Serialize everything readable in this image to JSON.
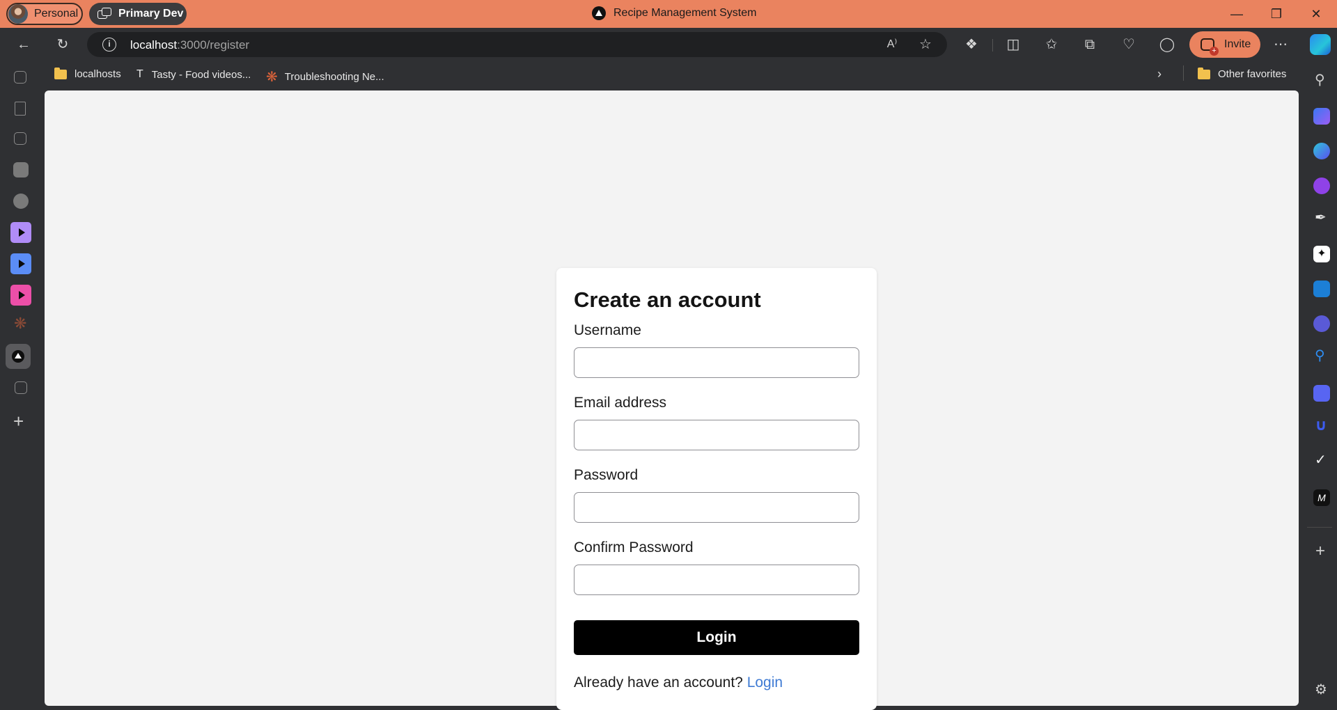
{
  "browser": {
    "window_title": "Recipe Management System",
    "profile_name": "Personal",
    "workspace_name": "Primary Dev",
    "url_host": "localhost",
    "url_path": ":3000/register",
    "invite_label": "Invite",
    "favorites": [
      {
        "label": "localhosts",
        "icon": "folder-icon"
      },
      {
        "label": "Tasty - Food videos...",
        "icon": "tasty-icon"
      },
      {
        "label": "Troubleshooting Ne...",
        "icon": "burst-icon"
      }
    ],
    "other_favorites": "Other favorites"
  },
  "form": {
    "title": "Create an account",
    "username_label": "Username",
    "email_label": "Email address",
    "password_label": "Password",
    "confirm_label": "Confirm Password",
    "username_value": "",
    "email_value": "",
    "password_value": "",
    "confirm_value": "",
    "submit_label": "Login",
    "footer_text": "Already have an account?",
    "footer_link": "Login"
  },
  "colors": {
    "titlebar": "#ea835f",
    "chrome": "#2f3033",
    "page_bg": "#f3f3f3",
    "button": "#000000",
    "link": "#3f7bd4"
  }
}
